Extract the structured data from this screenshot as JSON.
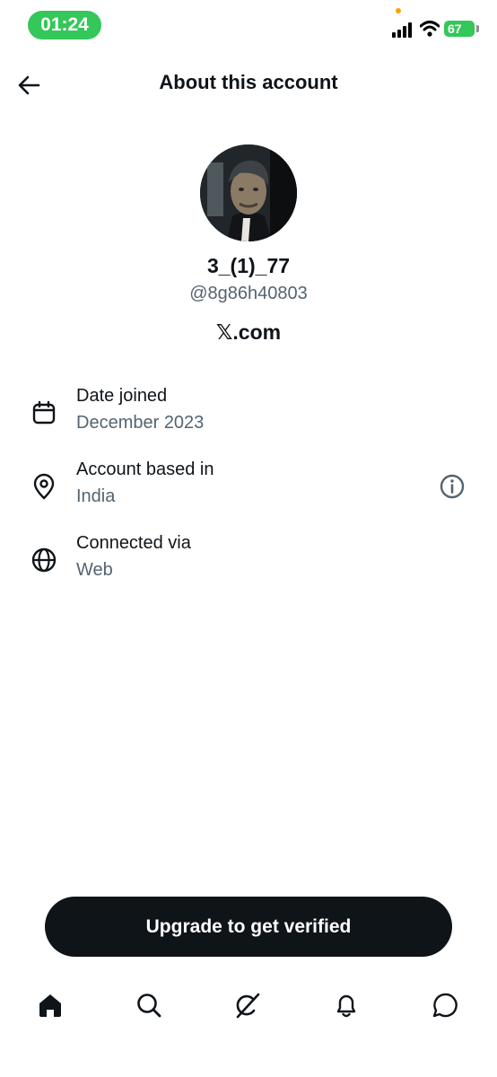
{
  "status_bar": {
    "time": "01:24",
    "battery": "67",
    "colors": {
      "time_pill": "#34c759",
      "battery": "#34c759",
      "camera_dot": "#ff9f0a"
    }
  },
  "header": {
    "title": "About this account",
    "back_icon": "arrow-left-icon"
  },
  "profile": {
    "display_name": "3_(1)_77",
    "handle": "@8g86h40803",
    "platform": "𝕏.com",
    "avatar_icon": "profile-avatar"
  },
  "info": [
    {
      "icon": "calendar-icon",
      "label": "Date joined",
      "value": "December 2023"
    },
    {
      "icon": "location-pin-icon",
      "label": "Account based in",
      "value": "India",
      "action_icon": "info-icon"
    },
    {
      "icon": "globe-icon",
      "label": "Connected via",
      "value": "Web"
    }
  ],
  "upgrade_button": {
    "label": "Upgrade to get verified"
  },
  "bottom_nav": [
    {
      "name": "home",
      "icon": "home-icon",
      "active": true
    },
    {
      "name": "search",
      "icon": "search-icon"
    },
    {
      "name": "grok",
      "icon": "grok-icon"
    },
    {
      "name": "notifications",
      "icon": "bell-icon"
    },
    {
      "name": "messages",
      "icon": "chat-bubble-icon"
    }
  ],
  "colors": {
    "text_primary": "#0f1419",
    "text_secondary": "#536471",
    "button_bg": "#0f1419"
  }
}
